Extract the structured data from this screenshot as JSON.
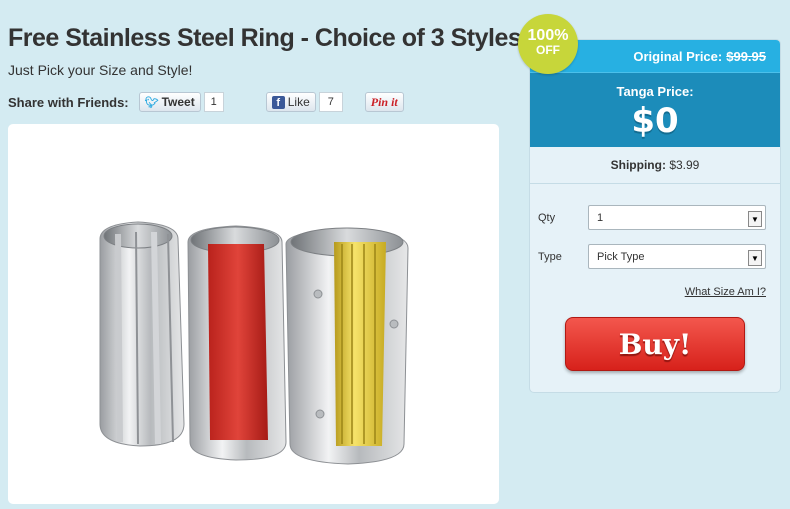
{
  "product": {
    "title": "Free Stainless Steel Ring - Choice of 3 Styles",
    "subtitle": "Just Pick your Size and Style!"
  },
  "share": {
    "label": "Share with Friends:",
    "tweet_label": "Tweet",
    "tweet_count": "1",
    "like_label": "Like",
    "like_count": "7",
    "pin_label": "Pin it"
  },
  "badge": {
    "percent": "100%",
    "off": "OFF"
  },
  "pricing": {
    "original_label": "Original Price:",
    "original_value": "$99.95",
    "tanga_label": "Tanga Price:",
    "tanga_value": "$0",
    "shipping_label": "Shipping:",
    "shipping_value": "$3.99"
  },
  "form": {
    "qty_label": "Qty",
    "qty_value": "1",
    "type_label": "Type",
    "type_value": "Pick Type",
    "size_link": "What Size Am I?",
    "buy_label": "Buy!"
  },
  "colors": {
    "accent_blue": "#27b0e2",
    "tanga_blue": "#1c8cba",
    "buy_red": "#d7211b",
    "badge_green": "#c7d63a"
  }
}
